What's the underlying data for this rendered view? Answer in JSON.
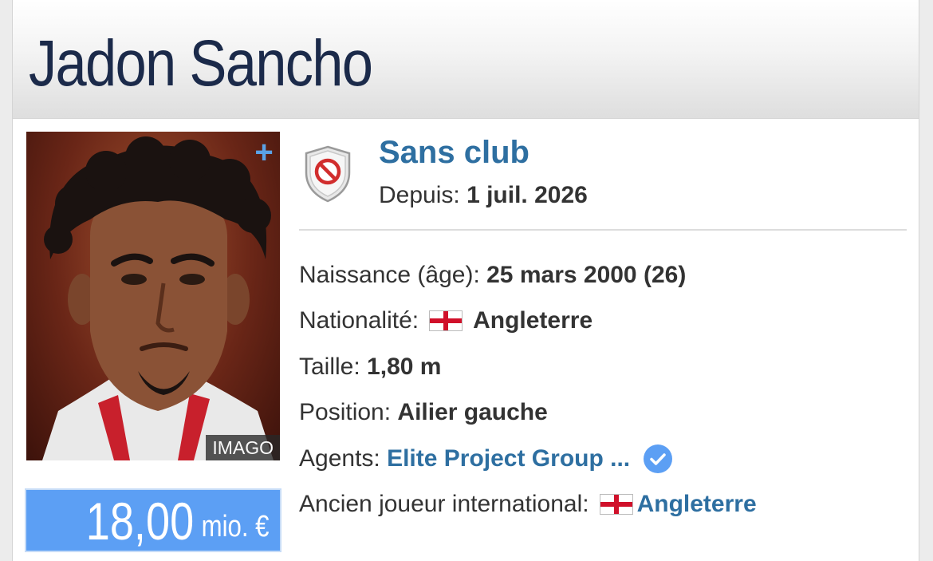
{
  "player": {
    "first_name": "Jadon",
    "last_name": "Sancho"
  },
  "photo": {
    "credit": "IMAGO",
    "expand_icon": "plus-icon"
  },
  "market_value": {
    "amount": "18,00",
    "unit": "mio. €"
  },
  "club": {
    "name": "Sans club",
    "since_label": "Depuis:",
    "since_value": "1 juil. 2026",
    "crest_icon": "no-club-shield-icon"
  },
  "info": {
    "birth": {
      "label": "Naissance (âge):",
      "value": "25 mars 2000 (26)"
    },
    "nationality": {
      "label": "Nationalité:",
      "value": "Angleterre",
      "flag": "england-flag-icon"
    },
    "height": {
      "label": "Taille:",
      "value": "1,80 m"
    },
    "position": {
      "label": "Position:",
      "value": "Ailier gauche"
    },
    "agents": {
      "label": "Agents:",
      "value": "Elite Project Group ...",
      "badge": "verified-icon"
    },
    "former_international": {
      "label": "Ancien joueur international:",
      "value": "Angleterre",
      "flag": "england-flag-icon"
    }
  },
  "colors": {
    "link": "#2e6fa1",
    "market_value_bg": "#5c9ff4",
    "name": "#1b2a4a"
  }
}
